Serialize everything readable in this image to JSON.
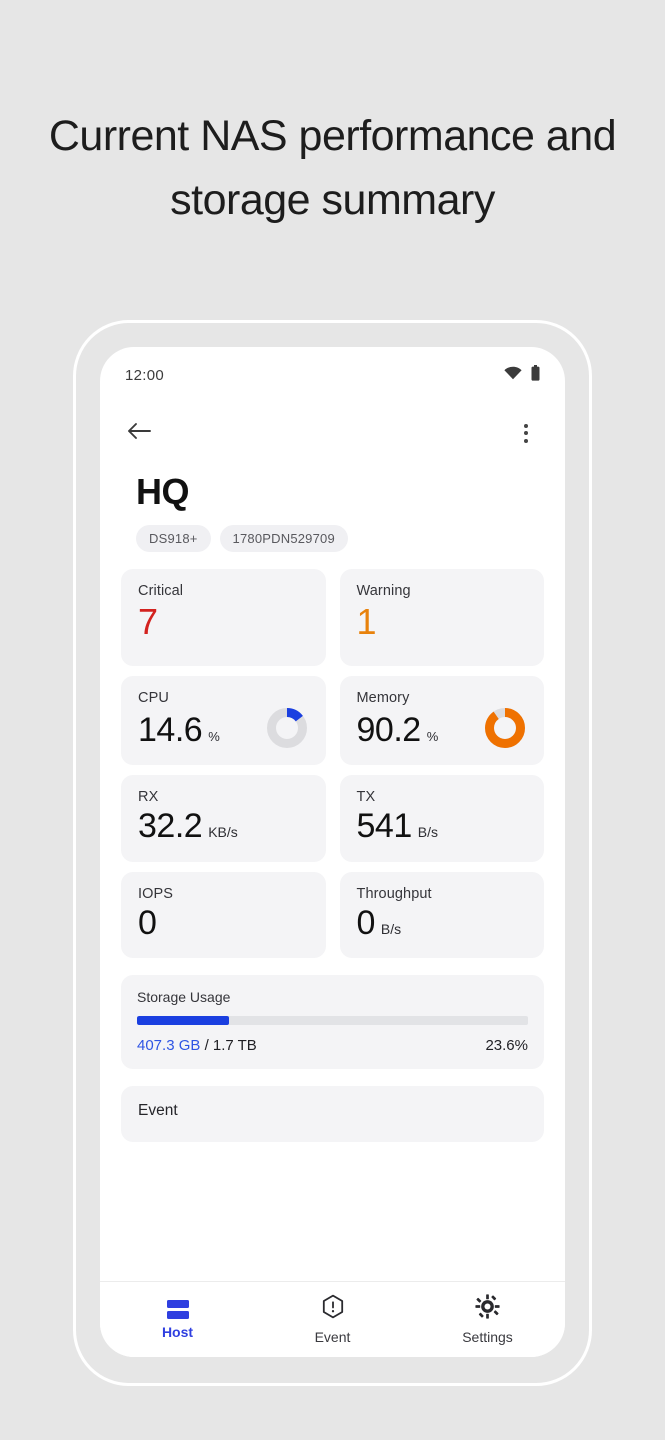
{
  "headline": "Current NAS performance and storage summary",
  "phone": {
    "status_bar": {
      "time": "12:00",
      "wifi_icon": "wifi-icon",
      "battery_icon": "battery-icon"
    },
    "app_bar": {
      "back_icon": "back-arrow-icon",
      "overflow_icon": "overflow-menu-icon"
    },
    "header": {
      "title": "HQ",
      "chips": [
        "DS918+",
        "1780PDN529709"
      ]
    },
    "metrics": [
      {
        "label": "Critical",
        "value": "7",
        "unit": "",
        "color": "#d3221f"
      },
      {
        "label": "Warning",
        "value": "1",
        "unit": "",
        "color": "#e8820c"
      },
      {
        "label": "CPU",
        "value": "14.6",
        "unit": "%",
        "gauge": 14.6,
        "gauge_color": "#1a3fe0"
      },
      {
        "label": "Memory",
        "value": "90.2",
        "unit": "%",
        "gauge": 90.2,
        "gauge_color": "#ef7100"
      },
      {
        "label": "RX",
        "value": "32.2",
        "unit": "KB/s"
      },
      {
        "label": "TX",
        "value": "541",
        "unit": "B/s"
      },
      {
        "label": "IOPS",
        "value": "0",
        "unit": ""
      },
      {
        "label": "Throughput",
        "value": "0",
        "unit": "B/s"
      }
    ],
    "storage": {
      "title": "Storage Usage",
      "used": "407.3 GB",
      "total": "/ 1.7 TB",
      "percent_label": "23.6%",
      "percent": 23.6,
      "fill_color": "#1a3fe0"
    },
    "event": {
      "title": "Event"
    },
    "bottom_nav": {
      "items": [
        {
          "label": "Host",
          "icon": "server-icon",
          "active": true
        },
        {
          "label": "Event",
          "icon": "alert-hexagon-icon",
          "active": false
        },
        {
          "label": "Settings",
          "icon": "gear-icon",
          "active": false
        }
      ],
      "active_color": "#2f3fe0"
    }
  }
}
